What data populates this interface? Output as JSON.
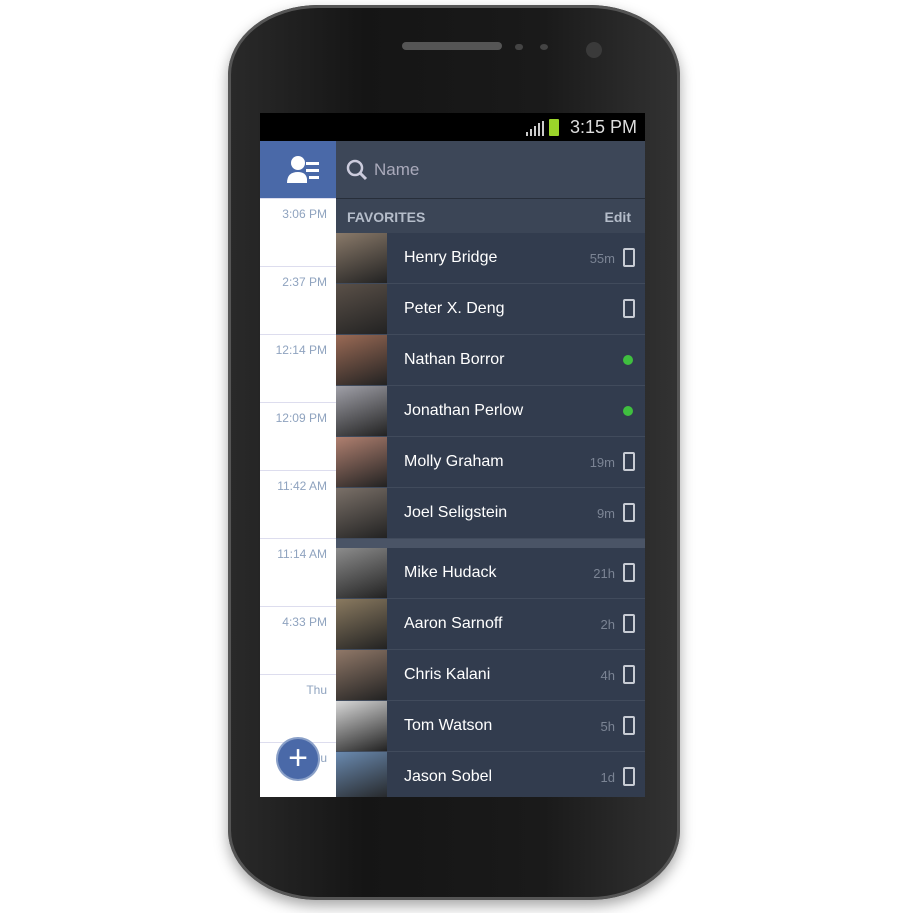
{
  "status": {
    "time": "3:15 PM"
  },
  "search": {
    "placeholder": "Name"
  },
  "favorites": {
    "title": "FAVORITES",
    "edit": "Edit"
  },
  "timestamps": [
    "3:06 PM",
    "2:37 PM",
    "12:14 PM",
    "12:09 PM",
    "11:42 AM",
    "11:14 AM",
    "4:33 PM",
    "Thu",
    "Thu"
  ],
  "favorite_contacts": [
    {
      "name": "Henry Bridge",
      "time": "55m",
      "status": "mobile"
    },
    {
      "name": "Peter X. Deng",
      "time": "",
      "status": "mobile"
    },
    {
      "name": "Nathan Borror",
      "time": "",
      "status": "online"
    },
    {
      "name": "Jonathan Perlow",
      "time": "",
      "status": "online"
    },
    {
      "name": "Molly Graham",
      "time": "19m",
      "status": "mobile"
    },
    {
      "name": "Joel Seligstein",
      "time": "9m",
      "status": "mobile"
    }
  ],
  "contacts": [
    {
      "name": "Mike Hudack",
      "time": "21h",
      "status": "mobile"
    },
    {
      "name": "Aaron Sarnoff",
      "time": "2h",
      "status": "mobile"
    },
    {
      "name": "Chris Kalani",
      "time": "4h",
      "status": "mobile"
    },
    {
      "name": "Tom Watson",
      "time": "5h",
      "status": "mobile"
    },
    {
      "name": "Jason Sobel",
      "time": "1d",
      "status": "mobile"
    }
  ],
  "colors": {
    "brand": "#4a69a8",
    "online": "#3fbf3f",
    "list_bg": "#323c4e"
  }
}
